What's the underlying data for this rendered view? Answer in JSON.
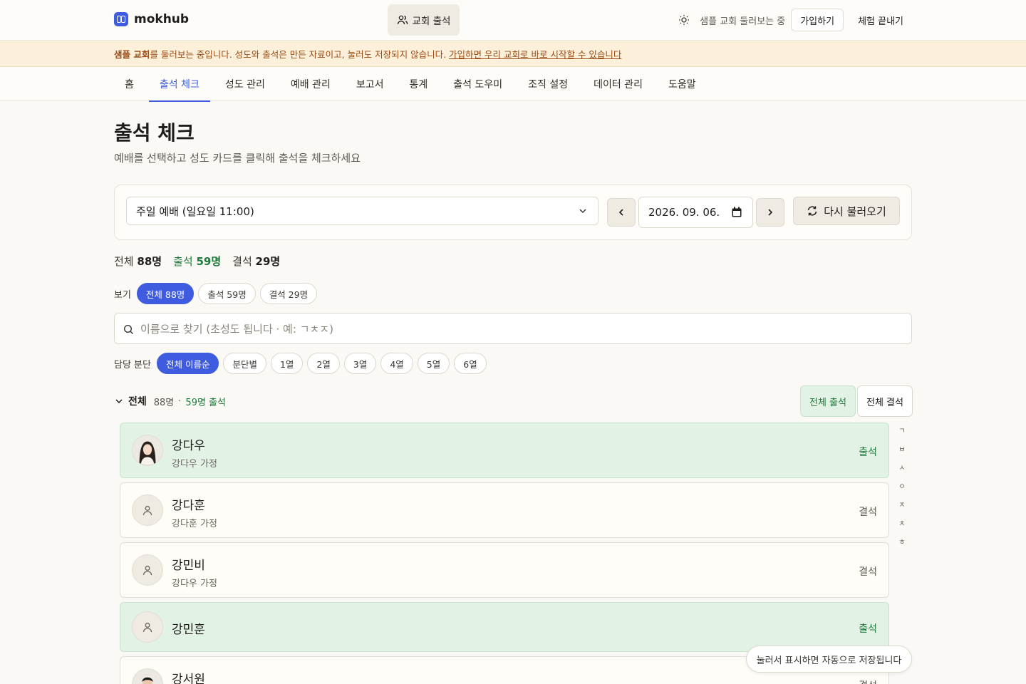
{
  "brand": {
    "name": "mokhub"
  },
  "header": {
    "church_button": "교회 출석",
    "demo_text": "샘플 교회 둘러보는 중",
    "signup": "가입하기",
    "end_trial": "체험 끝내기"
  },
  "notice": {
    "bold": "샘플 교회",
    "text": "를 둘러보는 중입니다. 성도와 출석은 만든 자료이고, 눌러도 저장되지 않습니다.",
    "link": "가입하면 우리 교회로 바로 시작할 수 있습니다"
  },
  "tabs": [
    {
      "label": "홈"
    },
    {
      "label": "출석 체크"
    },
    {
      "label": "성도 관리"
    },
    {
      "label": "예배 관리"
    },
    {
      "label": "보고서"
    },
    {
      "label": "통계"
    },
    {
      "label": "출석 도우미"
    },
    {
      "label": "조직 설정"
    },
    {
      "label": "데이터 관리"
    },
    {
      "label": "도움말"
    }
  ],
  "active_tab": "출석 체크",
  "page": {
    "title": "출석 체크",
    "subtitle": "예배를 선택하고 성도 카드를 클릭해 출석을 체크하세요"
  },
  "controls": {
    "service": "주일 예배 (일요일 11:00)",
    "date": "2026. 09. 06.",
    "reload": "다시 불러오기"
  },
  "summary": {
    "total_label": "전체",
    "total": "88명",
    "present_label": "출석",
    "present": "59명",
    "absent_label": "결석",
    "absent": "29명"
  },
  "view_filter": {
    "label": "보기",
    "options": [
      "전체 88명",
      "출석 59명",
      "결석 29명"
    ],
    "selected": "전체 88명"
  },
  "search": {
    "placeholder": "이름으로 찾기 (초성도 됩니다 · 예: ㄱㅊㅈ)"
  },
  "group_filter": {
    "label": "담당 분단",
    "options": [
      "전체 이름순",
      "분단별",
      "1열",
      "2열",
      "3열",
      "4열",
      "5열",
      "6열"
    ],
    "selected": "전체 이름순"
  },
  "section": {
    "title": "전체",
    "count": "88명",
    "sep": "·",
    "present": "59명 출석",
    "all_present": "전체 출석",
    "all_absent": "전체 결석"
  },
  "members": [
    {
      "name": "강다우",
      "family": "강다우 가정",
      "status": "출석",
      "photo": true
    },
    {
      "name": "강다훈",
      "family": "강다훈 가정",
      "status": "결석",
      "photo": false
    },
    {
      "name": "강민비",
      "family": "강다우 가정",
      "status": "결석",
      "photo": false
    },
    {
      "name": "강민훈",
      "family": "",
      "status": "출석",
      "photo": false
    },
    {
      "name": "강서원",
      "family": "",
      "status": "결석",
      "photo": true
    }
  ],
  "index_letters": [
    "ㄱ",
    "ㅂ",
    "ㅅ",
    "ㅇ",
    "ㅈ",
    "ㅊ",
    "ㅎ"
  ],
  "toast": "눌러서 표시하면 자동으로 저장됩니다",
  "colors": {
    "accent": "#3f5ce0",
    "present": "#1f7a3c",
    "present_bg": "#e2f2e4",
    "notice_bg": "#fdf0db"
  }
}
